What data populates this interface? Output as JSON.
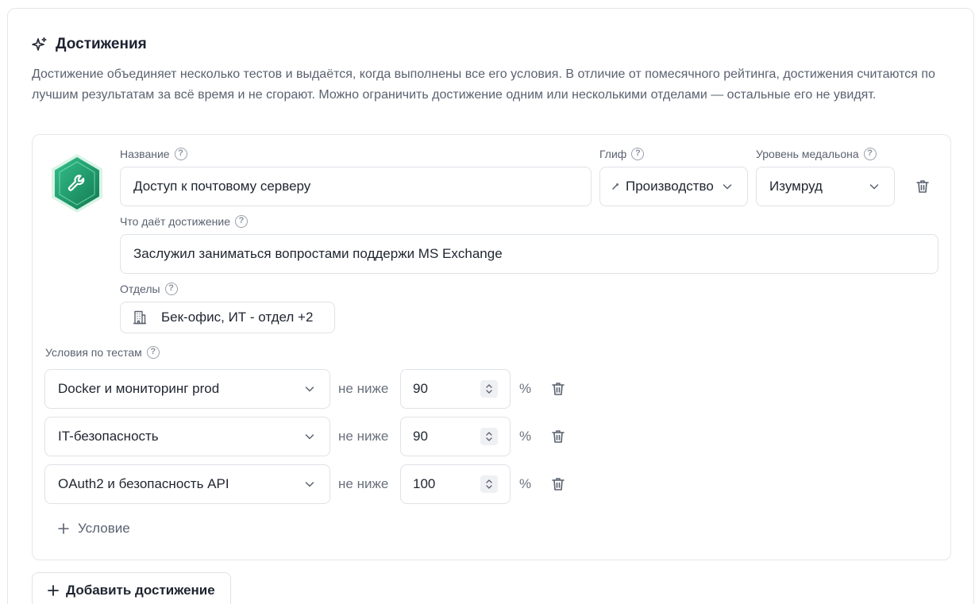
{
  "section": {
    "title": "Достижения",
    "icon": "sparkles-icon",
    "description": "Достижение объединяет несколько тестов и выдаётся, когда выполнены все его условия. В отличие от помесячного рейтинга, достижения считаются по лучшим результатам за всё время и не сгорают. Можно ограничить достижение одним или несколькими отделами — остальные его не увидят."
  },
  "achievement": {
    "medal": {
      "icon": "wrench-icon",
      "color": "#1f9e6e"
    },
    "name_label": "Название",
    "name_value": "Доступ к почтовому серверу",
    "glyph_label": "Глиф",
    "glyph_value": "Производство",
    "medal_level_label": "Уровень медальона",
    "medal_level_value": "Изумруд",
    "grants_label": "Что даёт достижение",
    "grants_value": "Заслужил заниматься вопростами поддержи MS Exchange",
    "departments_label": "Отделы",
    "departments_value": "Бек-офис, ИТ - отдел +2",
    "conditions_label": "Условия по тестам",
    "conditions": [
      {
        "test": "Docker и мониторинг prod",
        "op": "не ниже",
        "value": "90",
        "unit": "%"
      },
      {
        "test": "IT-безопасность",
        "op": "не ниже",
        "value": "90",
        "unit": "%"
      },
      {
        "test": "OAuth2 и безопасность API",
        "op": "не ниже",
        "value": "100",
        "unit": "%"
      }
    ],
    "add_condition_label": "Условие"
  },
  "add_achievement_label": "Добавить достижение",
  "help_glyph": "?"
}
